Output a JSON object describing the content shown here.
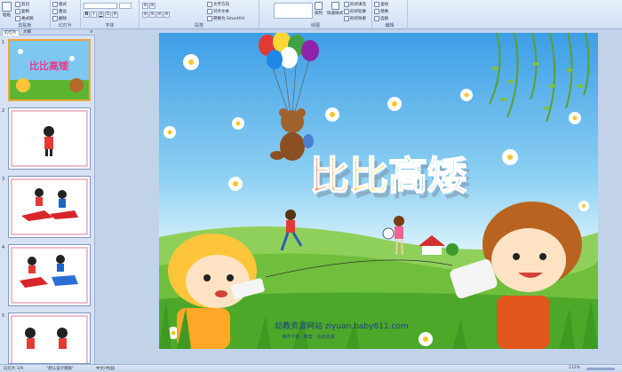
{
  "ribbon": {
    "clipboard": {
      "paste": "粘贴",
      "copy": "复制",
      "format_painter": "格式刷",
      "cut": "剪切",
      "label": "剪贴板"
    },
    "slides": {
      "new_slide": "新建\n幻灯片",
      "layout": "版式",
      "reset": "重设",
      "delete": "删除",
      "label": "幻灯片"
    },
    "font": {
      "font_name": "",
      "font_size": "",
      "label": "字体"
    },
    "paragraph": {
      "text_direction": "文字方向",
      "align_text": "对齐文本",
      "smartart": "转换为 SmartArt",
      "label": "段落"
    },
    "drawing": {
      "arrange": "排列",
      "quick_styles": "快速样式",
      "shape_fill": "形状填充",
      "shape_outline": "形状轮廓",
      "shape_effects": "形状效果",
      "label": "绘图"
    },
    "editing": {
      "find": "查找",
      "replace": "替换",
      "select": "选择",
      "label": "编辑"
    }
  },
  "left_pane": {
    "tab_slides": "幻灯片",
    "tab_outline": "大纲",
    "close": "×",
    "thumbnails": [
      {
        "num": "1",
        "title": "比比高矮"
      },
      {
        "num": "2"
      },
      {
        "num": "3"
      },
      {
        "num": "4"
      },
      {
        "num": "5"
      }
    ]
  },
  "slide": {
    "title": "比比高矮",
    "watermark_line1": "幼教资源网站  ziyuan.baby611.com",
    "watermark_line2": "课件下载 · 教案 · 活动资源"
  },
  "status": {
    "slide_info": "幻灯片 1/9",
    "theme": "\"默认设计模板\"",
    "language": "中文(中国)",
    "zoom": "112%"
  },
  "colors": {
    "title_gradient": [
      "#ff3b2f",
      "#ff9c00",
      "#ffe100",
      "#2fc53c",
      "#2aa2ff",
      "#a347ff"
    ],
    "grass": "#5cb531",
    "sky": "#3d9ee6"
  }
}
